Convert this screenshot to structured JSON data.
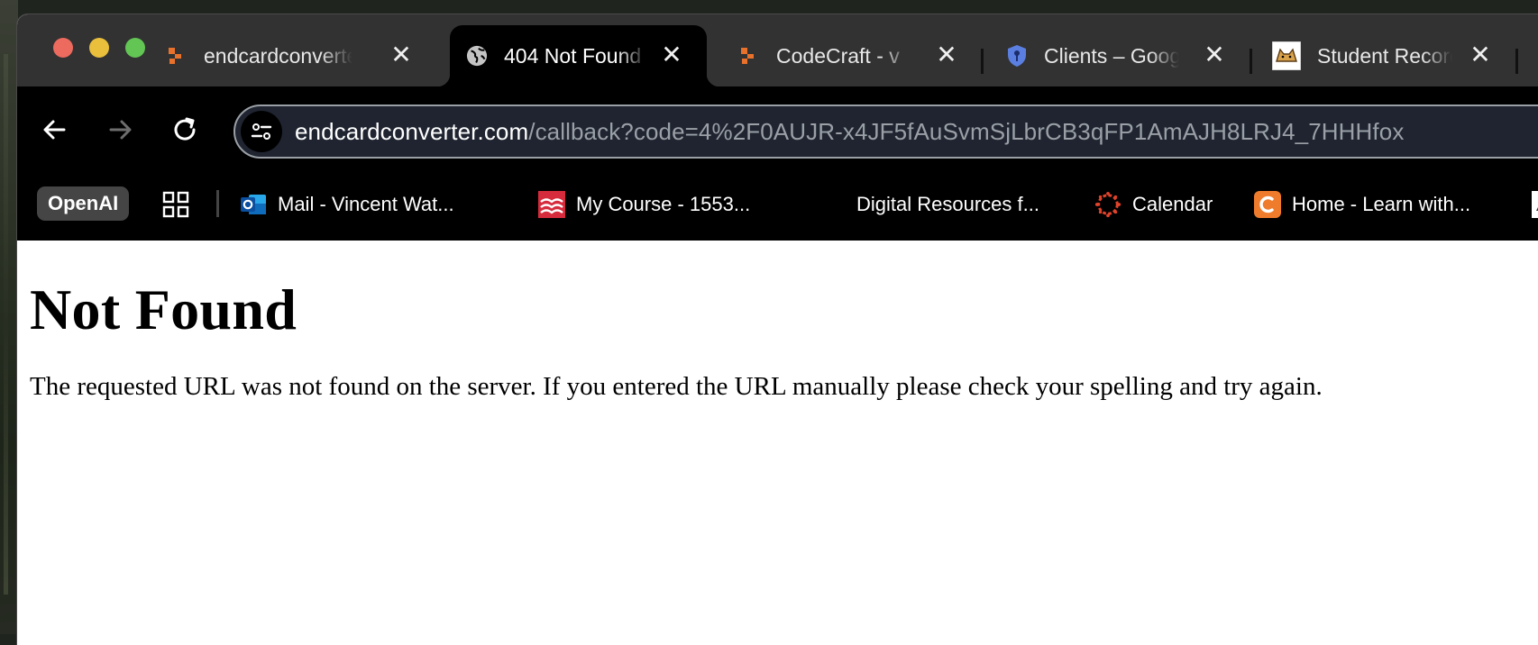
{
  "tabs": [
    {
      "title": "endcardconverter",
      "favicon": "endcard-orange-icon",
      "active": false
    },
    {
      "title": "404 Not Found",
      "favicon": "globe-icon",
      "active": true
    },
    {
      "title": "CodeCraft - v",
      "favicon": "codecraft-orange-icon",
      "active": false
    },
    {
      "title": "Clients – Google",
      "favicon": "shield-key-icon",
      "active": false
    },
    {
      "title": "Student Records",
      "favicon": "cat-logo-icon",
      "active": false
    }
  ],
  "address_bar": {
    "host": "endcardconverter.com",
    "path": "/callback?code=4%2F0AUJR-x4JF5fAuSvmSjLbrCB3qFP1AmAJH8LRJ4_7HHHfox"
  },
  "bookmarks": {
    "pill_label": "OpenAI",
    "items": [
      {
        "label": "Mail - Vincent Wat...",
        "icon": "outlook-icon"
      },
      {
        "label": "My Course - 1553...",
        "icon": "course-red-icon"
      },
      {
        "label": "Digital Resources f...",
        "icon": "none"
      },
      {
        "label": "Calendar",
        "icon": "canvas-calendar-icon"
      },
      {
        "label": "Home - Learn with...",
        "icon": "learn-orange-c-icon"
      }
    ]
  },
  "page": {
    "heading": "Not Found",
    "message": "The requested URL was not found on the server. If you entered the URL manually please check your spelling and try again."
  },
  "colors": {
    "tabbar": "#323232",
    "toolbar": "#000000",
    "traffic_red": "#ed6a5e",
    "traffic_yellow": "#e9bf3c",
    "traffic_green": "#62c554"
  }
}
